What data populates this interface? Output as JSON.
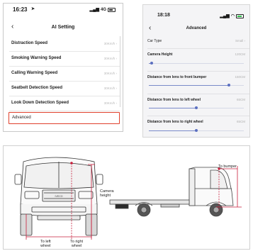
{
  "phone1": {
    "status_time": "16:23",
    "status_network": "4G",
    "nav_title": "AI Setting",
    "rows": [
      {
        "label": "Distraction Speed",
        "value": "30Km/h"
      },
      {
        "label": "Smoking Warning Speed",
        "value": "30Km/h"
      },
      {
        "label": "Calling Warning Speed",
        "value": "30Km/h"
      },
      {
        "label": "Seatbelt Detection Speed",
        "value": "30Km/h"
      },
      {
        "label": "Look Down Detection Speed",
        "value": "30Km/h"
      },
      {
        "label": "Advanced",
        "value": ""
      }
    ]
  },
  "phone2": {
    "status_time": "18:18",
    "nav_title": "Advanced",
    "car_type_label": "Car Type",
    "car_type_value": "Small",
    "settings": [
      {
        "label": "Camera Height",
        "value": "120CM",
        "fraction": 0.03
      },
      {
        "label": "Distance from lens to front bumper",
        "value": "150CM",
        "fraction": 0.84
      },
      {
        "label": "Distance from lens to left wheel",
        "value": "65CM",
        "fraction": 0.5
      },
      {
        "label": "Distance from lens to right wheel",
        "value": "65CM",
        "fraction": 0.5
      }
    ]
  },
  "illustration": {
    "camera_height_label": "Camera\nheight",
    "to_bumper_label": "To bumper",
    "to_left_wheel_label": "To left\nwheel",
    "to_right_wheel_label": "To right\nwheel",
    "grille_text": "IVECO"
  },
  "colors": {
    "highlight": "#e0402c",
    "measure_line": "#c81f3c",
    "slider": "#5b6fc0"
  }
}
